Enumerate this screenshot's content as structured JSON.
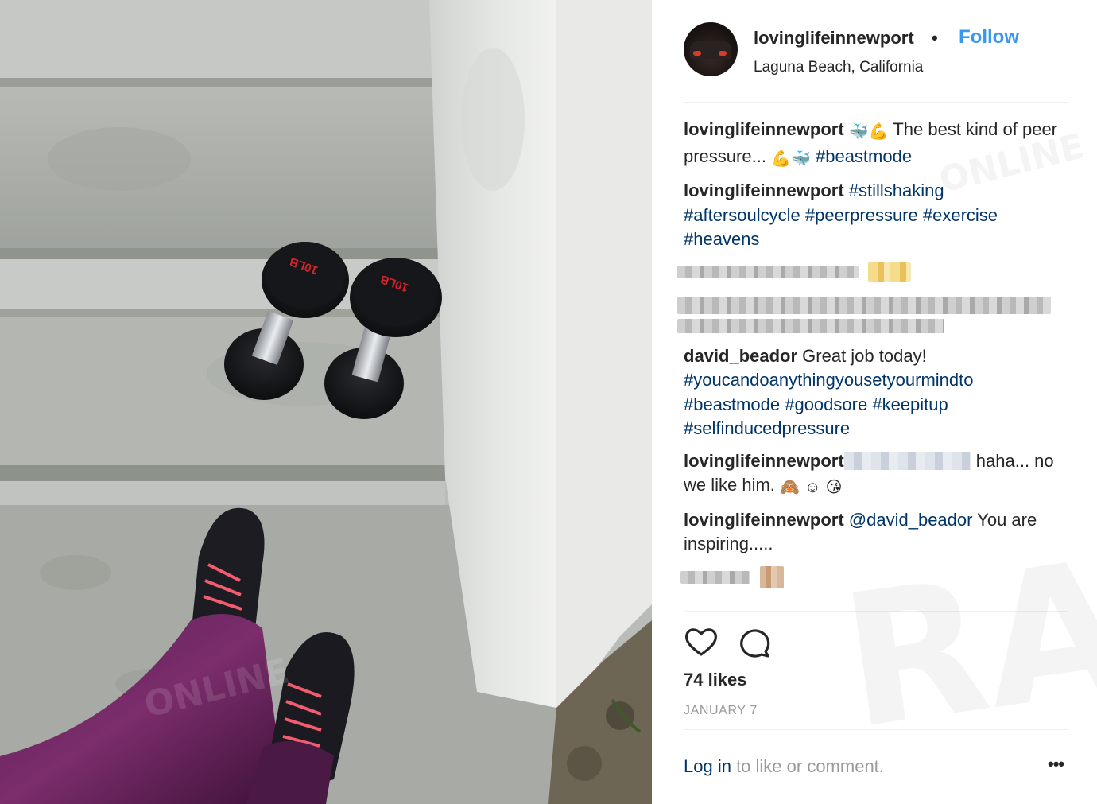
{
  "post": {
    "username": "lovinglifeinnewport",
    "separator": "•",
    "follow_label": "Follow",
    "location": "Laguna Beach, California"
  },
  "photo": {
    "dumbbell_label_left": "10LB",
    "dumbbell_label_right": "10LB"
  },
  "comments": [
    {
      "user": "lovinglifeinnewport",
      "emoji1": "🐳",
      "emoji2": "💪",
      "text1": " The best kind of peer pressure... ",
      "emoji3": "💪",
      "emoji4": "🐳",
      "tag1": "#beastmode"
    },
    {
      "user": "lovinglifeinnewport",
      "tags": [
        "#stillshaking",
        "#aftersoulcycle",
        "#peerpressure",
        "#exercise",
        "#heavens"
      ]
    },
    {
      "user": "david_beador",
      "text": " Great job today! ",
      "tags": [
        "#youcandoanythingyousetyourmindto",
        "#beastmode",
        "#goodsore",
        "#keepitup",
        "#selfinducedpressure"
      ]
    },
    {
      "user": "lovinglifeinnewport",
      "text_end": " haha... no we like him. ",
      "emoji1": "🙈",
      "emoji2": "☺",
      "emoji3": "😘"
    },
    {
      "user": "lovinglifeinnewport",
      "mention": "@david_beador",
      "text": " You are inspiring....."
    }
  ],
  "actions": {
    "like_icon": "heart-icon",
    "comment_icon": "comment-icon"
  },
  "likes": "74 likes",
  "date": "JANUARY 7",
  "footer": {
    "login_link": "Log in",
    "login_text": " to like or comment.",
    "more": "•••"
  },
  "watermark": {
    "text": "RADAR",
    "sub": "ONLINE"
  }
}
